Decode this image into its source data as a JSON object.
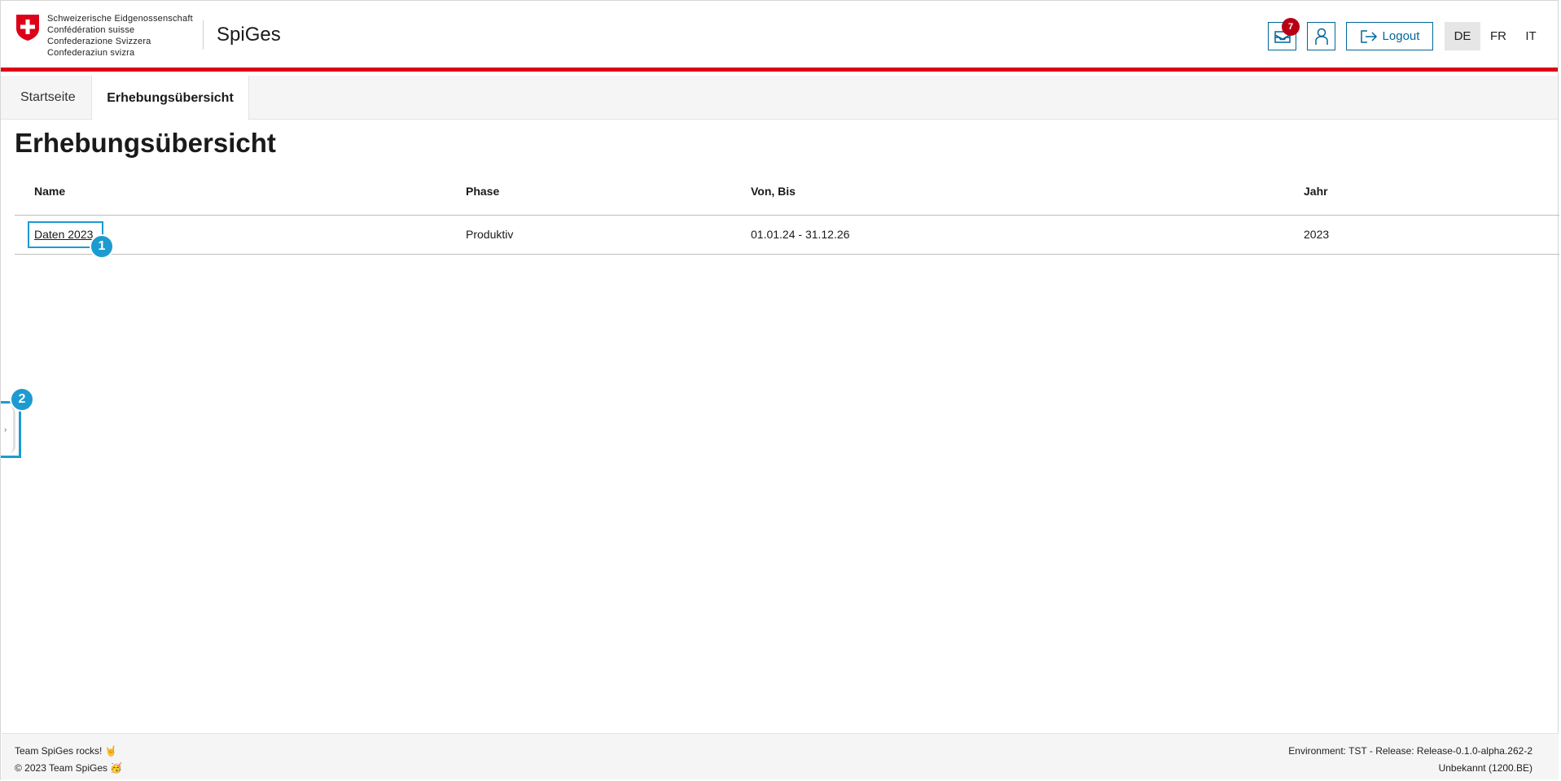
{
  "header": {
    "confederation_lines": [
      "Schweizerische Eidgenossenschaft",
      "Confédération suisse",
      "Confederazione Svizzera",
      "Confederaziun svizra"
    ],
    "app_title": "SpiGes",
    "inbox_badge": "7",
    "logout_label": "Logout",
    "languages": [
      "DE",
      "FR",
      "IT"
    ],
    "active_language": "DE",
    "accent_color": "#dc0018"
  },
  "tabs": [
    {
      "label": "Startseite",
      "active": false
    },
    {
      "label": "Erhebungsübersicht",
      "active": true
    }
  ],
  "main": {
    "title": "Erhebungsübersicht",
    "table": {
      "headers": [
        "Name",
        "Phase",
        "Von, Bis",
        "Jahr"
      ],
      "rows": [
        {
          "name": "Daten 2023",
          "phase": "Produktiv",
          "von_bis": "01.01.24 - 31.12.26",
          "jahr": "2023"
        }
      ]
    }
  },
  "markers": [
    "1",
    "2"
  ],
  "footer": {
    "left_line1": "Team SpiGes rocks! 🤘",
    "left_line2": "© 2023 Team SpiGes 🥳",
    "right_line1": "Environment: TST - Release: Release-0.1.0-alpha.262-2",
    "right_line2": "Unbekannt (1200.BE)"
  }
}
